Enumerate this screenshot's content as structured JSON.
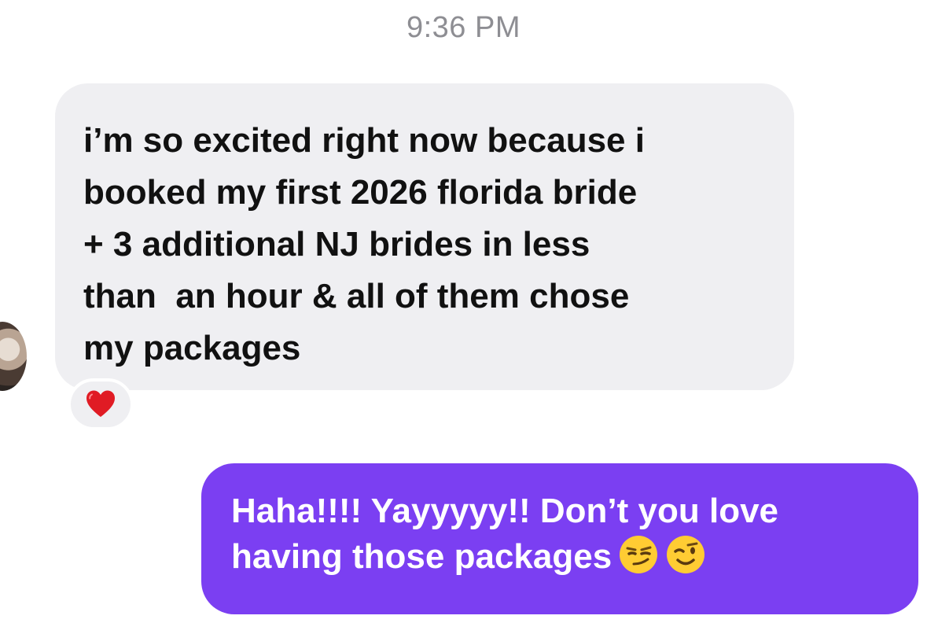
{
  "header": {
    "timestamp": "9:36 PM"
  },
  "messages": [
    {
      "sender": "other",
      "text": "i’m so excited right now because i\nbooked my first 2026 florida bride\n+ 3 additional NJ brides in less\nthan  an hour & all of them chose\nmy packages",
      "reaction": "red-heart-icon"
    },
    {
      "sender": "me",
      "text_line1": "Haha!!!! Yayyyyy!! Don’t you love",
      "text_line2": "having those packages",
      "emojis": [
        "smirking-face-icon",
        "winking-face-icon"
      ]
    }
  ],
  "colors": {
    "incoming_bubble": "#efeff2",
    "outgoing_bubble": "#7b3ff2",
    "timestamp": "#8e8e93"
  }
}
